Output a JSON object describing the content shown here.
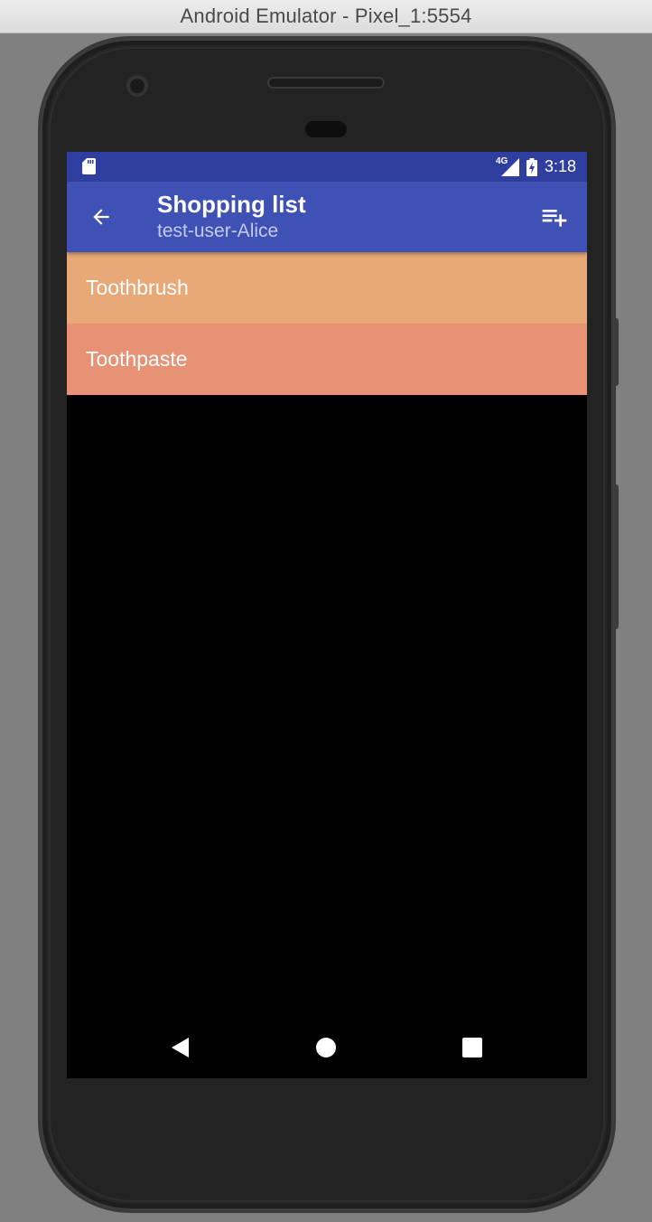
{
  "window": {
    "title": "Android Emulator - Pixel_1:5554"
  },
  "statusbar": {
    "network_label": "4G",
    "time": "3:18",
    "background": "#303f9f"
  },
  "toolbar": {
    "title": "Shopping list",
    "subtitle": "test-user-Alice",
    "back_icon": "arrow-back-icon",
    "action_icon": "playlist-add-icon",
    "background": "#3f51b5"
  },
  "list": {
    "items": [
      {
        "label": "Toothbrush",
        "color": "#e8a877"
      },
      {
        "label": "Toothpaste",
        "color": "#e79274"
      }
    ]
  },
  "navbar": {
    "back_icon": "triangle-back-icon",
    "home_icon": "circle-home-icon",
    "recents_icon": "square-recents-icon"
  }
}
